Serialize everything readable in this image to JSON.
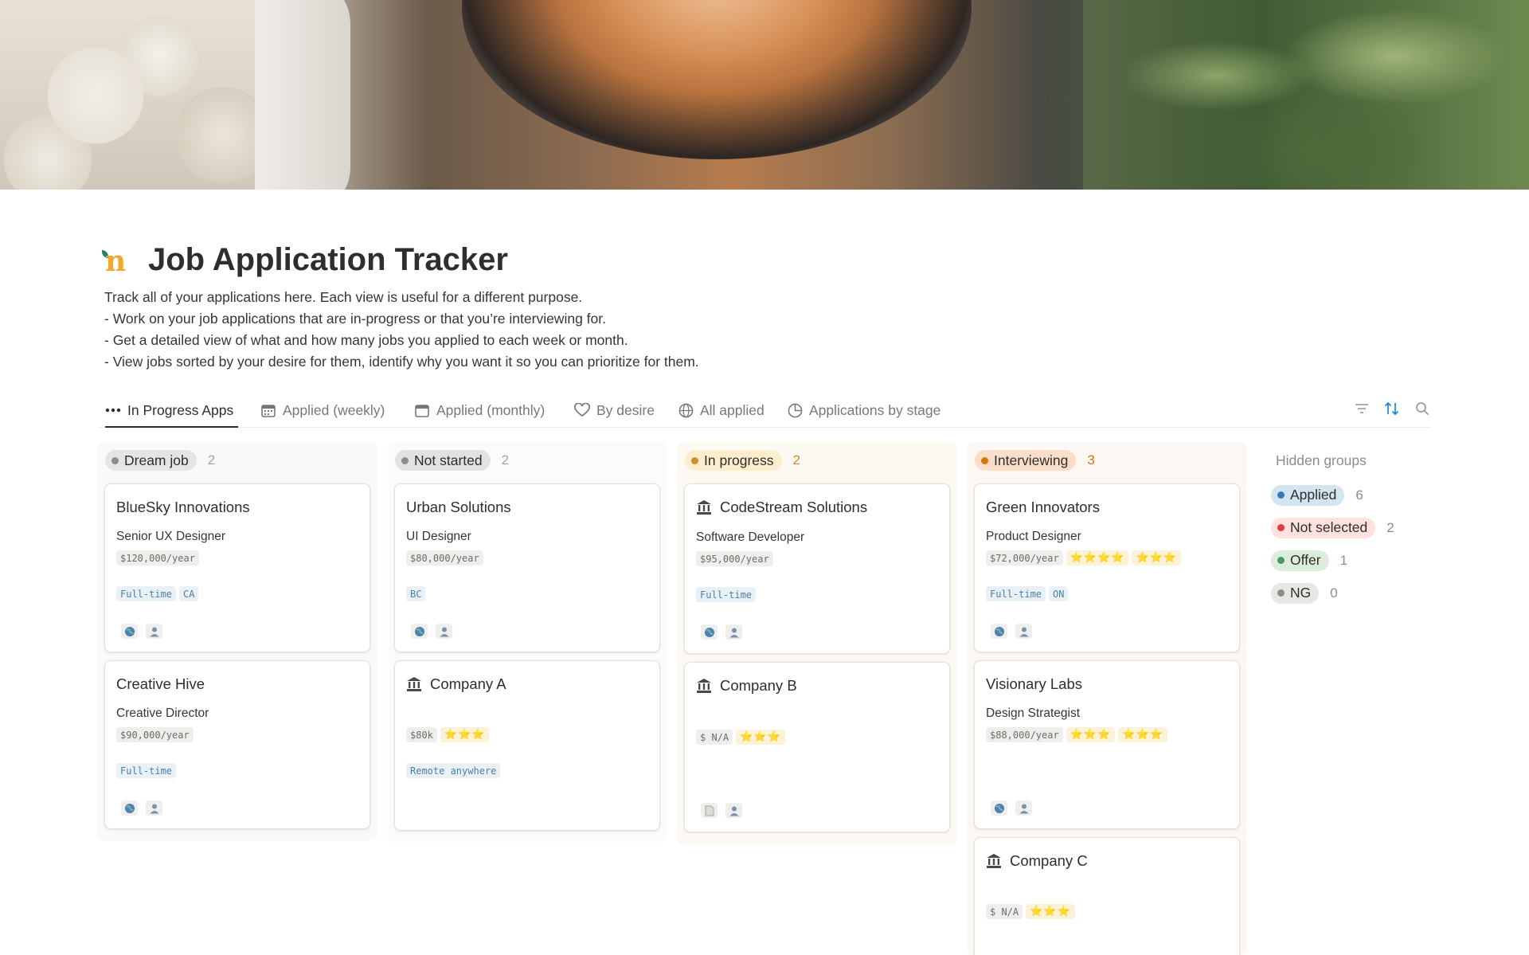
{
  "page": {
    "title": "Job Application Tracker",
    "description": [
      "Track all of your applications here. Each view is useful for a different purpose.",
      "- Work on your job applications that are in-progress or that you’re interviewing for.",
      "- Get a detailed view of what and how many jobs you applied to each week or month.",
      "- View jobs sorted by your desire for them, identify why you want it so you can prioritize for them."
    ]
  },
  "tabs": [
    {
      "label": "In Progress Apps",
      "icon": "more-horizontal-icon"
    },
    {
      "label": "Applied (weekly)",
      "icon": "calendar-icon"
    },
    {
      "label": "Applied (monthly)",
      "icon": "calendar-icon"
    },
    {
      "label": "By desire",
      "icon": "heart-icon"
    },
    {
      "label": "All applied",
      "icon": "globe-icon"
    },
    {
      "label": "Applications by stage",
      "icon": "pie-chart-icon"
    }
  ],
  "toolbar": {
    "icons": [
      "filter-icon",
      "sort-icon",
      "search-icon"
    ]
  },
  "columns": [
    {
      "group": "Dream job",
      "count": "2",
      "pill_bg": "#e6e5e3",
      "dot": "#8e8c88",
      "count_color": "#a5a4a0",
      "bg": "#f9f9f8",
      "cards": [
        {
          "company": "BlueSky Innovations",
          "role": "Senior UX Designer",
          "salary": "$120,000/year",
          "tags": [
            "Full-time",
            "CA"
          ]
        },
        {
          "company": "Creative Hive",
          "role": "Creative Director",
          "salary": "$90,000/year",
          "tags": [
            "Full-time"
          ]
        }
      ]
    },
    {
      "group": "Not started",
      "count": "2",
      "pill_bg": "#e3e2e0",
      "dot": "#8e8c88",
      "count_color": "#a5a4a0",
      "bg": "#fbfbfa",
      "cards": [
        {
          "company": "Urban Solutions",
          "role": "UI Designer",
          "salary": "$80,000/year",
          "tags": [
            "BC"
          ]
        },
        {
          "company": "Company A",
          "role": "",
          "salary": "$80k",
          "stars": "⭐⭐⭐",
          "tags": [
            "Remote anywhere"
          ]
        }
      ]
    },
    {
      "group": "In progress",
      "count": "2",
      "pill_bg": "#fbeecc",
      "dot": "#cb912f",
      "count_color": "#cb912f",
      "bg": "#fcf9f2",
      "cards": [
        {
          "company": "CodeStream Solutions",
          "role": "Software Developer",
          "salary": "$95,000/year",
          "tags": [
            "Full-time"
          ]
        },
        {
          "company": "Company B",
          "role": "",
          "salary": "$ N/A",
          "stars": "⭐⭐⭐",
          "tags": []
        }
      ]
    },
    {
      "group": "Interviewing",
      "count": "3",
      "pill_bg": "#fadec9",
      "dot": "#d9730d",
      "count_color": "#d9730d",
      "bg": "#fcf7f3",
      "cards": [
        {
          "company": "Green Innovators",
          "role": "Product Designer",
          "salary": "$72,000/year",
          "stars": "⭐⭐⭐⭐",
          "stars2": "⭐⭐⭐",
          "tags": [
            "Full-time",
            "ON"
          ]
        },
        {
          "company": "Visionary Labs",
          "role": "Design Strategist",
          "salary": "$88,000/year",
          "stars": "⭐⭐⭐",
          "stars2": "⭐⭐⭐",
          "tags": []
        },
        {
          "company": "Company C",
          "role": "",
          "salary": "$ N/A",
          "stars": "⭐⭐⭐",
          "tags": []
        }
      ]
    }
  ],
  "hidden_groups": {
    "label": "Hidden groups",
    "items": [
      {
        "name": "Applied",
        "count": "6",
        "pill_bg": "#d3e5ef",
        "dot": "#2e7cb8"
      },
      {
        "name": "Not selected",
        "count": "2",
        "pill_bg": "#ffe2dd",
        "dot": "#e03e3e"
      },
      {
        "name": "Offer",
        "count": "1",
        "pill_bg": "#dbeddb",
        "dot": "#4b9a5b"
      },
      {
        "name": "NG",
        "count": "0",
        "pill_bg": "#e8e7e4",
        "dot": "#8e8c88"
      }
    ]
  }
}
